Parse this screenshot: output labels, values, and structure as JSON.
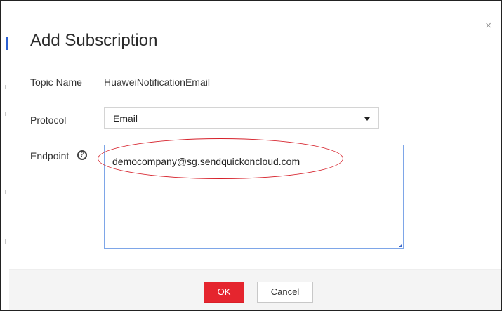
{
  "dialog": {
    "title": "Add Subscription",
    "close_glyph": "×"
  },
  "form": {
    "topic_name_label": "Topic Name",
    "topic_name_value": "HuaweiNotificationEmail",
    "protocol_label": "Protocol",
    "protocol_selected": "Email",
    "endpoint_label": "Endpoint",
    "endpoint_help_glyph": "?",
    "endpoint_value": "democompany@sg.sendquickoncloud.com"
  },
  "footer": {
    "ok_label": "OK",
    "cancel_label": "Cancel"
  },
  "icons": [
    "close-icon",
    "chevron-down-icon",
    "help-icon",
    "resize-grip-icon"
  ],
  "colors": {
    "primary_button": "#e5252e",
    "textarea_focus_border": "#7ea6e8",
    "annotation_ellipse": "#d6202a",
    "footer_background": "#f4f4f4"
  }
}
